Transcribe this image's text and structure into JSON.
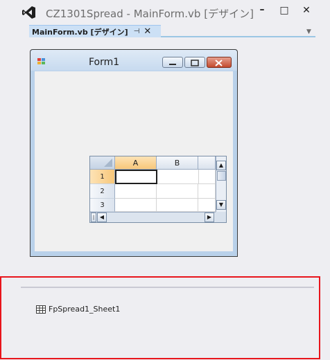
{
  "window": {
    "title": "CZ1301Spread - MainForm.vb [デザイン]",
    "minimize_glyph": "–",
    "maximize_glyph": "□",
    "close_glyph": "✕"
  },
  "tab": {
    "label": "MainForm.vb [デザイン]",
    "pin_glyph": "⊣",
    "close_glyph": "✕",
    "overflow_glyph": "▼"
  },
  "form": {
    "title": "Form1"
  },
  "spread": {
    "columns": [
      "A",
      "B"
    ],
    "rows": [
      "1",
      "2",
      "3"
    ],
    "active_cell": "A1"
  },
  "tray": {
    "component_label": "FpSpread1_Sheet1",
    "component_icon": "grid-table-icon"
  },
  "colors": {
    "accent": "#007acc",
    "highlight_border": "#e8141b",
    "active_header": "#f7c77a"
  }
}
